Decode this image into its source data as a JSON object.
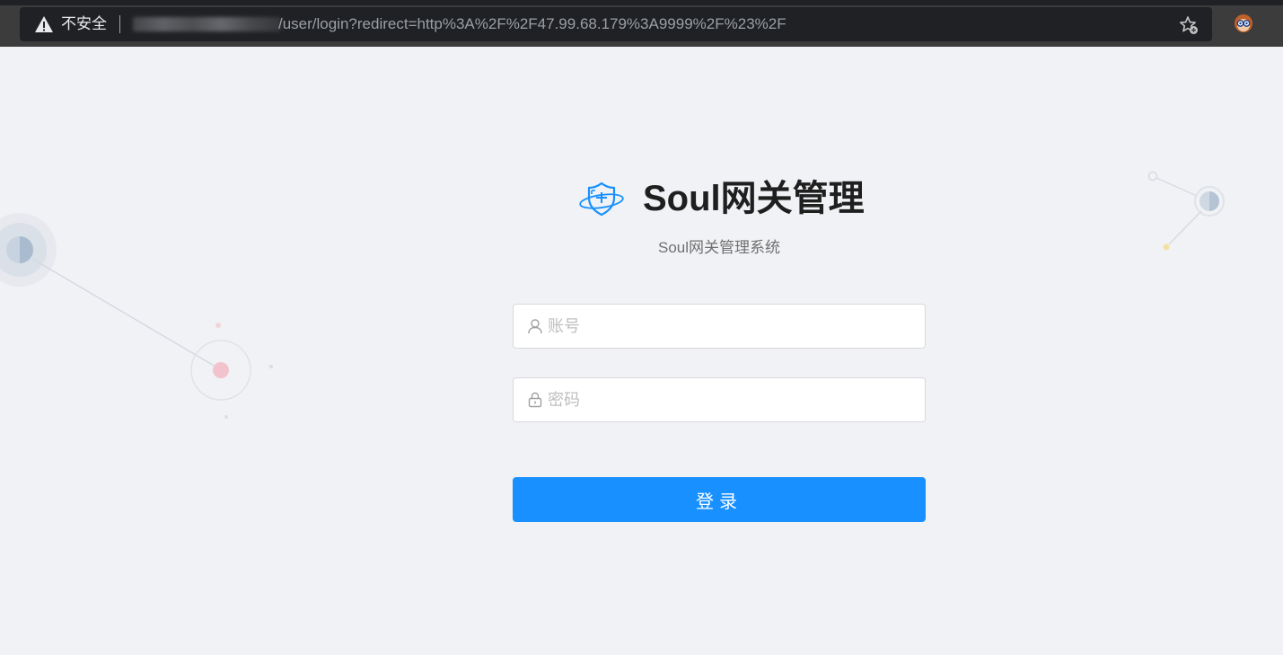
{
  "browser": {
    "security_label": "不安全",
    "url": "/user/login?redirect=http%3A%2F%2F47.99.68.179%3A9999%2F%23%2F"
  },
  "login": {
    "title": "Soul网关管理",
    "subtitle": "Soul网关管理系统",
    "username_placeholder": "账号",
    "password_placeholder": "密码",
    "submit_label": "登录"
  },
  "colors": {
    "primary": "#1890ff",
    "background": "#f0f2f5",
    "chrome": "#3c3c3c"
  },
  "icons": {
    "security": "warning-triangle-icon",
    "bookmark": "star-add-icon",
    "profile": "avatar-icon",
    "logo": "shield-logo-icon",
    "username": "user-icon",
    "password": "lock-icon"
  }
}
